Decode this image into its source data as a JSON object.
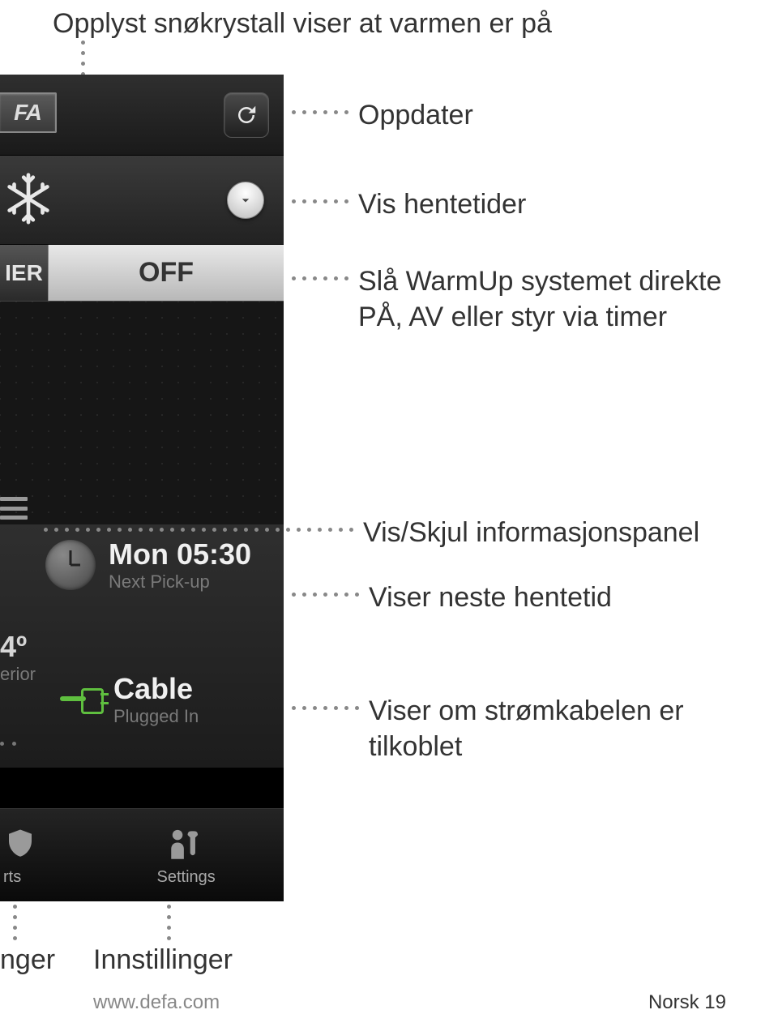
{
  "callouts": {
    "top": "Opplyst snøkrystall viser at varmen er på",
    "refresh": "Oppdater",
    "expand": "Vis hentetider",
    "off": "Slå WarmUp systemet direkte PÅ, AV eller styr via timer",
    "panel": "Vis/Skjul informasjonspanel",
    "pickup": "Viser neste hentetid",
    "cable": "Viser om strømkabelen er tilkoblet"
  },
  "phone": {
    "logo": "FA",
    "ier_tab": "IER",
    "off_label": "OFF",
    "pickup_time": "Mon 05:30",
    "pickup_sub": "Next Pick-up",
    "temp_value": "4º",
    "temp_sub": "erior",
    "cable_label": "Cable",
    "cable_sub": "Plugged In",
    "tabs": {
      "alerts": "rts",
      "settings": "Settings"
    }
  },
  "bottom": {
    "left": "nger",
    "settings": "Innstillinger"
  },
  "footer": {
    "url": "www.defa.com",
    "page_lang": "Norsk",
    "page_num": "19"
  }
}
